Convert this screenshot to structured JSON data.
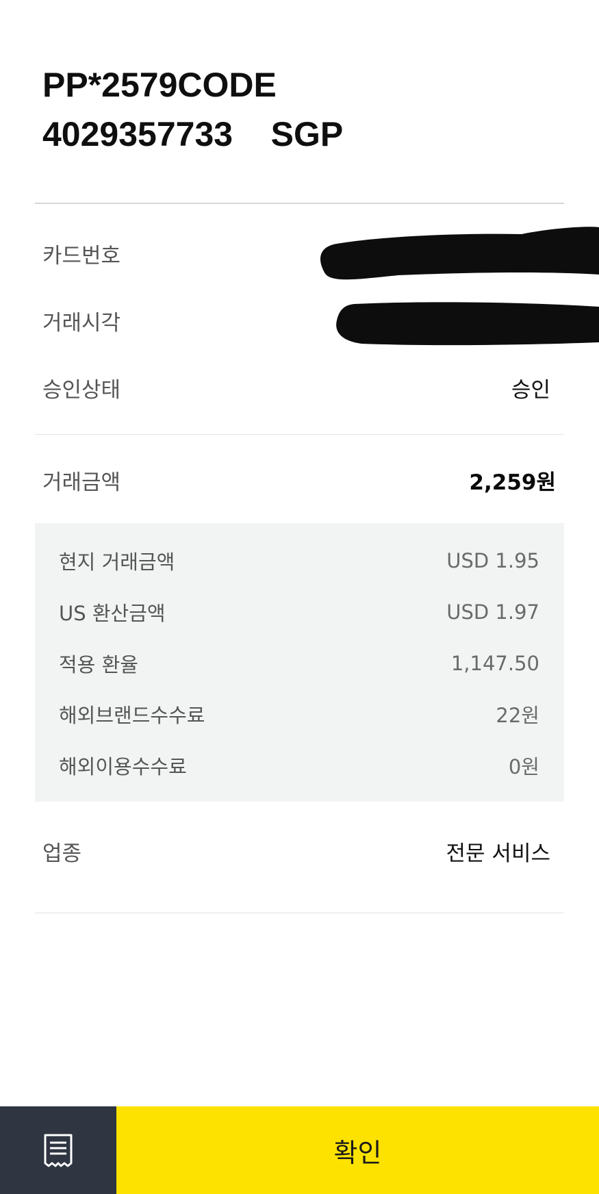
{
  "merchant": {
    "line1": "PP*2579CODE",
    "line2": "4029357733    SGP"
  },
  "transaction": {
    "card_number_label": "카드번호",
    "transaction_time_label": "거래시각",
    "approval_status_label": "승인상태",
    "approval_status_value": "승인",
    "amount_label": "거래금액",
    "amount_value": "2,259원"
  },
  "details": {
    "items": [
      {
        "label": "현지 거래금액",
        "value": "USD 1.95"
      },
      {
        "label": "US 환산금액",
        "value": "USD 1.97"
      },
      {
        "label": "적용 환율",
        "value": "1,147.50"
      },
      {
        "label": "해외브랜드수수료",
        "value": "22원"
      },
      {
        "label": "해외이용수수료",
        "value": "0원"
      }
    ]
  },
  "business": {
    "label": "업종",
    "value": "전문 서비스"
  },
  "bottom": {
    "receipt_icon": "receipt-icon",
    "confirm_label": "확인"
  },
  "colors": {
    "accent_yellow": "#fde200",
    "dark_bar": "#2f3541",
    "detail_bg": "#f2f4f4"
  }
}
